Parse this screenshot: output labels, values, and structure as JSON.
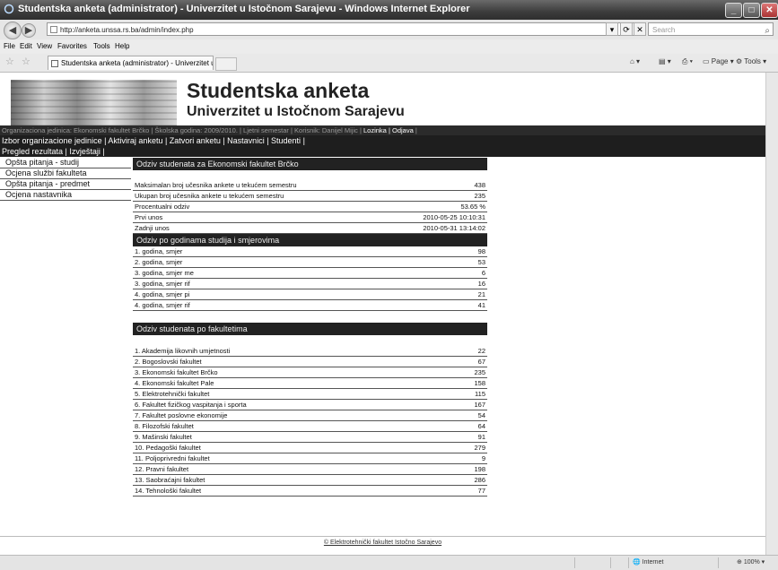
{
  "window": {
    "title": "Studentska anketa (administrator) - Univerzitet u Istočnom Sarajevu - Windows Internet Explorer",
    "url": "http://anketa.unssa.rs.ba/admin/index.php",
    "search_placeholder": "Search",
    "menu": [
      "File",
      "Edit",
      "View",
      "Favorites",
      "Tools",
      "Help"
    ],
    "tab_title": "Studentska anketa (administrator) - Univerzitet u Isto...",
    "toolbar_cmds": {
      "page": "Page",
      "tools": "Tools"
    },
    "status": {
      "zone": "Internet",
      "zoom": "100%"
    }
  },
  "header": {
    "title": "Studentska anketa",
    "subtitle": "Univerzitet u Istočnom Sarajevu"
  },
  "infobar": {
    "text": "Organizaciona jedinica: Ekonomski fakultet Brčko | Školska godina: 2009/2010. | Ljetni semestar | Korisnik: Danijel Mijic | ",
    "lozinka": "Lozinka",
    "sep": " | ",
    "odjava": "Odjava",
    "end": " |"
  },
  "nav1": [
    "Izbor organizacione jedinice",
    "Aktiviraj anketu",
    "Zatvori anketu",
    "Nastavnici",
    "Studenti"
  ],
  "nav2": [
    "Pregled rezultata",
    "Izvještaji"
  ],
  "sidebar": [
    "Opšta pitanja - studij",
    "Ocjena službi fakulteta",
    "Opšta pitanja - predmet",
    "Ocjena nastavnika"
  ],
  "section1": {
    "title": "Odziv studenata za Ekonomski fakultet Brčko",
    "rows": [
      {
        "label": "Maksimalan broj učesnika ankete u tekućem semestru",
        "value": "438"
      },
      {
        "label": "Ukupan broj učesnika ankete u tekućem semestru",
        "value": "235"
      },
      {
        "label": "Procentualni odziv",
        "value": "53.65 %"
      },
      {
        "label": "Prvi unos",
        "value": "2010-05-25 10:10:31"
      },
      {
        "label": "Zadnji unos",
        "value": "2010-05-31 13:14:02"
      }
    ]
  },
  "section2": {
    "title": "Odziv po godinama studija i smjerovima",
    "rows": [
      {
        "label": "1. godina, smjer",
        "value": "98"
      },
      {
        "label": "2. godina, smjer",
        "value": "53"
      },
      {
        "label": "3. godina, smjer me",
        "value": "6"
      },
      {
        "label": "3. godina, smjer rif",
        "value": "16"
      },
      {
        "label": "4. godina, smjer pi",
        "value": "21"
      },
      {
        "label": "4. godina, smjer rif",
        "value": "41"
      }
    ]
  },
  "section3": {
    "title": "Odziv studenata po fakultetima",
    "rows": [
      {
        "label": "1. Akademija likovnih umjetnosti",
        "value": "22"
      },
      {
        "label": "2. Bogoslovski fakultet",
        "value": "67"
      },
      {
        "label": "3. Ekonomski fakultet Brčko",
        "value": "235"
      },
      {
        "label": "4. Ekonomski fakultet Pale",
        "value": "158"
      },
      {
        "label": "5. Elektrotehnički fakultet",
        "value": "115"
      },
      {
        "label": "6. Fakultet fizičkog vaspitanja i sporta",
        "value": "167"
      },
      {
        "label": "7. Fakultet poslovne ekonomije",
        "value": "54"
      },
      {
        "label": "8. Filozofski fakultet",
        "value": "64"
      },
      {
        "label": "9. Mašinski fakultet",
        "value": "91"
      },
      {
        "label": "10. Pedagoški fakultet",
        "value": "279"
      },
      {
        "label": "11. Poljoprivredni fakultet",
        "value": "9"
      },
      {
        "label": "12. Pravni fakultet",
        "value": "198"
      },
      {
        "label": "13. Saobraćajni fakultet",
        "value": "286"
      },
      {
        "label": "14. Tehnološki fakultet",
        "value": "77"
      }
    ]
  },
  "footer": "© Elektrotehnički fakultet Istočno Sarajevo"
}
